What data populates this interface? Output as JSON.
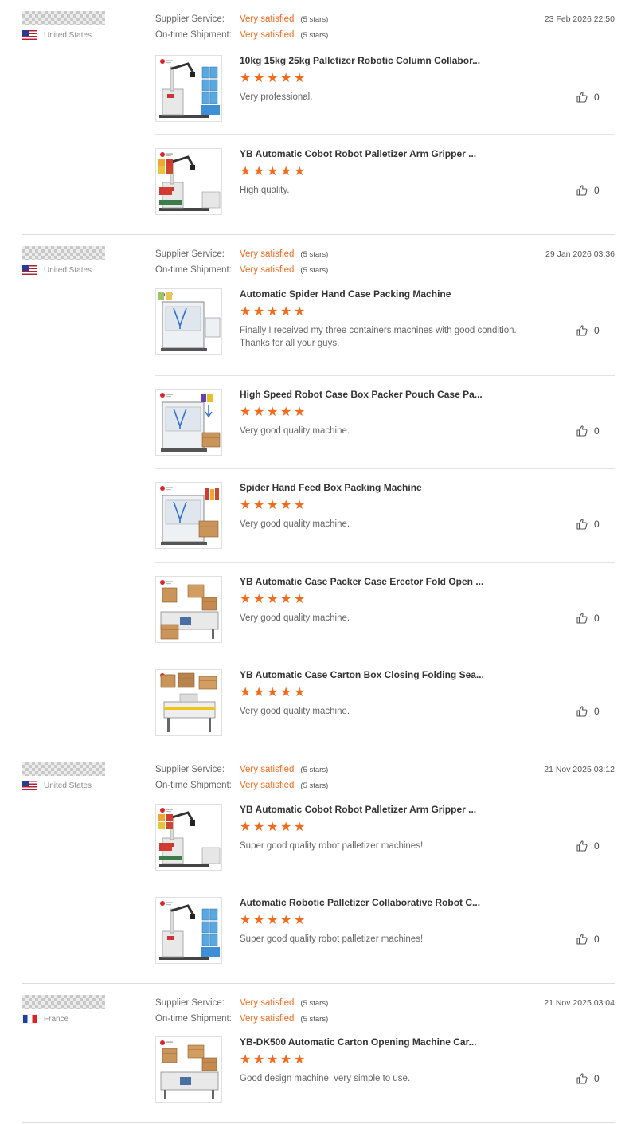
{
  "labels": {
    "supplier_service": "Supplier Service:",
    "ontime_shipment": "On-time Shipment:",
    "satisfied": "Very satisfied",
    "five_stars": "(5 stars)"
  },
  "colors": {
    "accent": "#f26b1d",
    "muted_text": "#666666",
    "divider": "#dcdcdc"
  },
  "reviews": [
    {
      "country": "United States",
      "flag": "us-flag-icon",
      "date": "23 Feb 2026 22:50",
      "products": [
        {
          "title": "10kg 15kg 25kg Palletizer Robotic Column Collabor...",
          "rating": 5,
          "text": "Very professional.",
          "likes": "0"
        },
        {
          "title": "YB Automatic Cobot Robot Palletizer Arm Gripper ...",
          "rating": 5,
          "text": "High quality.",
          "likes": "0"
        }
      ]
    },
    {
      "country": "United States",
      "flag": "us-flag-icon",
      "date": "29 Jan 2026 03:36",
      "products": [
        {
          "title": "Automatic Spider Hand Case Packing Machine",
          "rating": 5,
          "text": "Finally I received my three containers machines with good condition. Thanks for all your guys.",
          "likes": "0"
        },
        {
          "title": "High Speed Robot Case Box Packer Pouch Case Pa...",
          "rating": 5,
          "text": "Very good quality machine.",
          "likes": "0"
        },
        {
          "title": "Spider Hand Feed Box Packing Machine",
          "rating": 5,
          "text": "Very good quality machine.",
          "likes": "0"
        },
        {
          "title": "YB Automatic Case Packer Case Erector Fold Open ...",
          "rating": 5,
          "text": "Very good quality machine.",
          "likes": "0"
        },
        {
          "title": "YB Automatic Case Carton Box Closing Folding Sea...",
          "rating": 5,
          "text": "Very good quality machine.",
          "likes": "0"
        }
      ]
    },
    {
      "country": "United States",
      "flag": "us-flag-icon",
      "date": "21 Nov 2025 03:12",
      "products": [
        {
          "title": "YB Automatic Cobot Robot Palletizer Arm Gripper ...",
          "rating": 5,
          "text": "Super good quality robot palletizer machines!",
          "likes": "0"
        },
        {
          "title": "Automatic Robotic Palletizer Collaborative Robot C...",
          "rating": 5,
          "text": "Super good quality robot palletizer machines!",
          "likes": "0"
        }
      ]
    },
    {
      "country": "France",
      "flag": "fr-flag-icon",
      "date": "21 Nov 2025 03:04",
      "products": [
        {
          "title": "YB-DK500 Automatic Carton Opening Machine Car...",
          "rating": 5,
          "text": "Good design machine, very simple to use.",
          "likes": "0"
        }
      ]
    }
  ]
}
